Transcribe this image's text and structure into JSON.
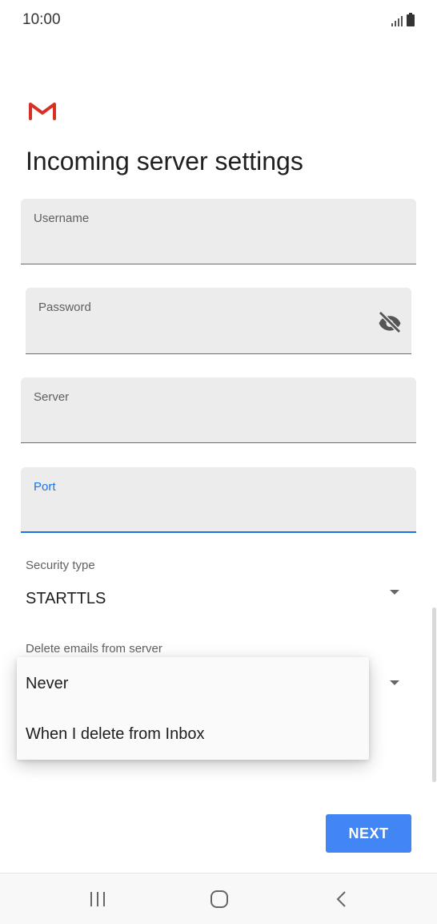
{
  "status_bar": {
    "time": "10:00",
    "signal_icon": "signal-icon",
    "battery_icon": "battery-icon"
  },
  "header": {
    "logo_icon": "gmail-logo-icon",
    "title": "Incoming server settings"
  },
  "fields": {
    "username": {
      "label": "Username",
      "value": ""
    },
    "password": {
      "label": "Password",
      "value": "",
      "toggle_icon": "visibility-off-icon"
    },
    "server": {
      "label": "Server",
      "value": ""
    },
    "port": {
      "label": "Port",
      "value": "",
      "focused": true
    }
  },
  "security_type": {
    "label": "Security type",
    "value": "STARTTLS"
  },
  "delete_emails": {
    "label": "Delete emails from server",
    "options": [
      "Never",
      "When I delete from Inbox"
    ]
  },
  "actions": {
    "next_label": "NEXT"
  },
  "nav": {
    "recents_icon": "recents-icon",
    "home_icon": "home-icon",
    "back_icon": "back-icon"
  },
  "colors": {
    "accent": "#4285f4",
    "focus": "#1a73e8",
    "field_bg": "#ececec",
    "gmail_red": "#d93025"
  }
}
